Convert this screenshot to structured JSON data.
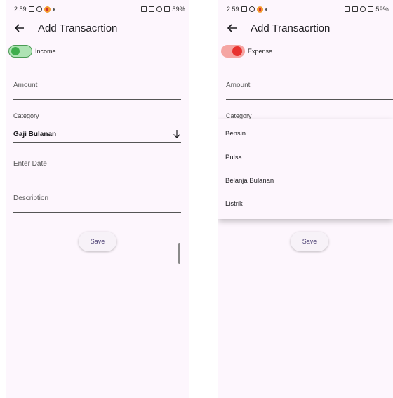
{
  "screens": [
    {
      "status": {
        "time": "2.59",
        "right": "59%"
      },
      "app_bar": {
        "title": "Add Transacrtion"
      },
      "switch": {
        "label": "Income",
        "state": "on",
        "color": "#3fae4d"
      },
      "fields": {
        "amount_placeholder": "Amount",
        "category_label": "Category",
        "category_value": "Gaji Bulanan",
        "date_placeholder": "Enter Date",
        "description_placeholder": "Description"
      },
      "save_label": "Save"
    },
    {
      "status": {
        "time": "2.59",
        "right": "59%"
      },
      "app_bar": {
        "title": "Add Transacrtion"
      },
      "switch": {
        "label": "Expense",
        "state": "off",
        "color": "#e8322f"
      },
      "fields": {
        "amount_placeholder": "Amount",
        "category_label": "Category"
      },
      "dropdown_options": [
        "Bensin",
        "Pulsa",
        "Belanja Bulanan",
        "Listrik"
      ],
      "save_label": "Save"
    }
  ]
}
